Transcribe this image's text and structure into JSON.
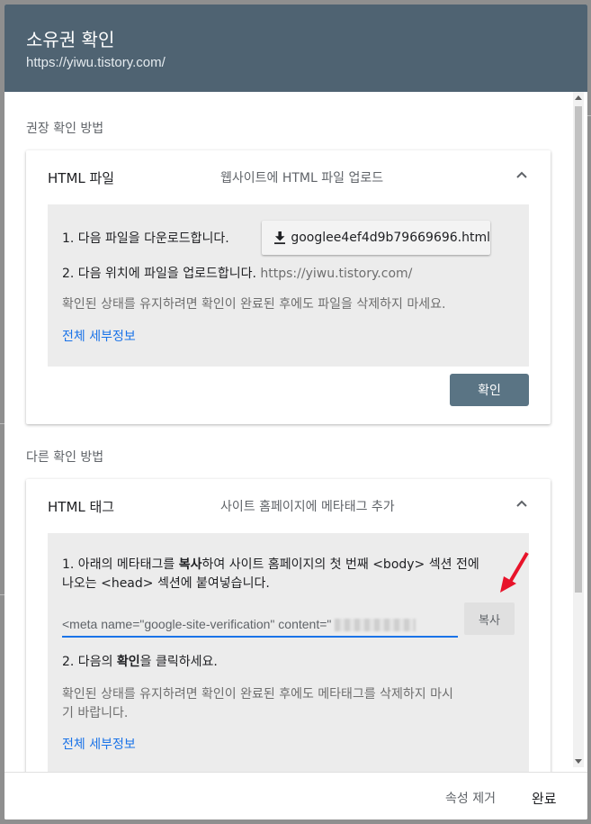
{
  "dialog": {
    "title": "소유권 확인",
    "url": "https://yiwu.tistory.com/"
  },
  "recommended": {
    "label": "권장 확인 방법",
    "card": {
      "title": "HTML 파일",
      "subtitle": "웹사이트에 HTML 파일 업로드",
      "step1": "1. 다음 파일을 다운로드합니다.",
      "download_label": "googlee4ef4d9b79669696.html",
      "step2": "2. 다음 위치에 파일을 업로드합니다.",
      "step2_url": "https://yiwu.tistory.com/",
      "note": "확인된 상태를 유지하려면 확인이 완료된 후에도 파일을 삭제하지 마세요.",
      "details_link": "전체 세부정보",
      "confirm_label": "확인"
    }
  },
  "other": {
    "label": "다른 확인 방법",
    "card": {
      "title": "HTML 태그",
      "subtitle": "사이트 홈페이지에 메타태그 추가",
      "step1_line1_a": "1. 아래의 메타태그를 ",
      "step1_line1_bold": "복사",
      "step1_line1_b": "하여 사이트 홈페이지의 첫 번째 <body> 섹션 전에",
      "step1_line2": "나오는 <head> 섹션에 붙여넣습니다.",
      "meta_value": "<meta name=\"google-site-verification\" content=\"",
      "copy_label": "복사",
      "step2_a": "2. 다음의 ",
      "step2_bold": "확인",
      "step2_b": "을 클릭하세요.",
      "note_line1": "확인된 상태를 유지하려면 확인이 완료된 후에도 메타태그를 삭제하지 마시",
      "note_line2": "기 바랍니다.",
      "details_link": "전체 세부정보"
    }
  },
  "footer": {
    "remove_label": "속성 제거",
    "done_label": "완료"
  },
  "colors": {
    "header_bg": "#4f6372",
    "confirm_bg": "#5a7484",
    "link": "#1a73e8",
    "annotation_arrow": "#e8132a"
  },
  "icons": [
    "download-icon",
    "chevron-up-icon",
    "annotation-arrow-icon"
  ]
}
